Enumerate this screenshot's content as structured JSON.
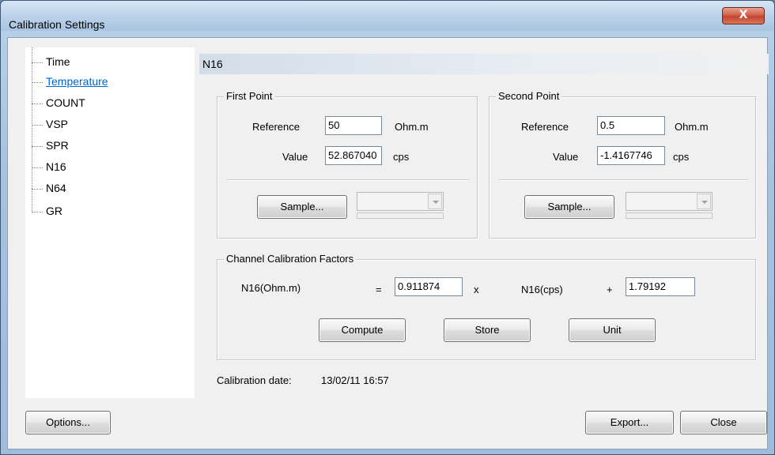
{
  "window": {
    "title": "Calibration Settings",
    "close_glyph": "X"
  },
  "tree": {
    "items": [
      {
        "label": "Time"
      },
      {
        "label": "Temperature"
      },
      {
        "label": "COUNT"
      },
      {
        "label": "VSP"
      },
      {
        "label": "SPR"
      },
      {
        "label": "N16"
      },
      {
        "label": "N64"
      },
      {
        "label": "GR"
      }
    ]
  },
  "panel": {
    "header": "N16",
    "first_point": {
      "title": "First Point",
      "reference_label": "Reference",
      "reference_value": "50",
      "reference_unit": "Ohm.m",
      "value_label": "Value",
      "value_value": "52.867040",
      "value_unit": "cps",
      "sample_button": "Sample..."
    },
    "second_point": {
      "title": "Second Point",
      "reference_label": "Reference",
      "reference_value": "0.5",
      "reference_unit": "Ohm.m",
      "value_label": "Value",
      "value_value": "-1.4167746",
      "value_unit": "cps",
      "sample_button": "Sample..."
    },
    "factors": {
      "title": "Channel Calibration Factors",
      "lhs_label": "N16(Ohm.m)",
      "equals": "=",
      "multiplier": "0.911874",
      "times": "x",
      "rhs_label": "N16(cps)",
      "plus": "+",
      "offset": "1.79192",
      "compute_button": "Compute",
      "store_button": "Store",
      "unit_button": "Unit"
    },
    "calibration_date_label": "Calibration date:",
    "calibration_date_value": "13/02/11 16:57"
  },
  "footer": {
    "options_button": "Options...",
    "export_button": "Export...",
    "close_button": "Close"
  }
}
